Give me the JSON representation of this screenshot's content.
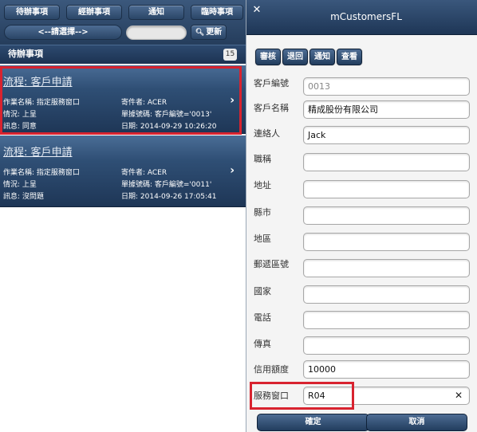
{
  "left": {
    "toolbar": {
      "buttons": [
        "待辦事項",
        "經辦事項",
        "通知",
        "臨時事項"
      ],
      "select_label": "<--請選擇-->",
      "search_value": "",
      "refresh_label": "更新"
    },
    "list": {
      "header": "待辦事項",
      "count": "15",
      "items": [
        {
          "title": "流程: 客戶申請",
          "task": "作業名稱: 指定服務窗口",
          "sender": "寄件者: ACER",
          "status": "情況: 上呈",
          "doc": "單據號碼: 客戶編號='0013'",
          "message": "訊息: 同意",
          "date": "日期: 2014-09-29 10:26:20"
        },
        {
          "title": "流程: 客戶申請",
          "task": "作業名稱: 指定服務窗口",
          "sender": "寄件者: ACER",
          "status": "情況: 上呈",
          "doc": "單據號碼: 客戶編號='0011'",
          "message": "訊息: 沒問題",
          "date": "日期: 2014-09-26 17:05:41"
        }
      ]
    }
  },
  "right": {
    "title": "mCustomersFL",
    "actions": [
      "審核",
      "退回",
      "通知",
      "查看"
    ],
    "fields": [
      {
        "label": "客戶編號",
        "value": "0013"
      },
      {
        "label": "客戶名稱",
        "value": "精成股份有限公司"
      },
      {
        "label": "連絡人",
        "value": "Jack"
      },
      {
        "label": "職稱",
        "value": ""
      },
      {
        "label": "地址",
        "value": ""
      },
      {
        "label": "縣市",
        "value": ""
      },
      {
        "label": "地區",
        "value": ""
      },
      {
        "label": "郵遞區號",
        "value": ""
      },
      {
        "label": "國家",
        "value": ""
      },
      {
        "label": "電話",
        "value": ""
      },
      {
        "label": "傳真",
        "value": ""
      },
      {
        "label": "信用額度",
        "value": "10000"
      },
      {
        "label": "服務窗口",
        "value": "R04"
      }
    ],
    "confirm_label": "確定",
    "cancel_label": "取消"
  },
  "colors": {
    "header_dark": "#1e3656",
    "header_light": "#3a577c",
    "highlight_red": "#d8232f"
  },
  "icons": [
    "search-icon",
    "chevron-right-icon",
    "close-icon",
    "clear-icon"
  ]
}
